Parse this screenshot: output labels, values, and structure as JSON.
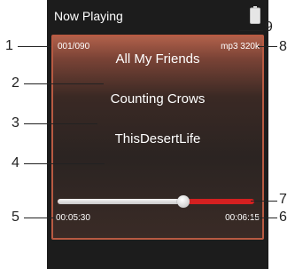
{
  "header": {
    "title": "Now Playing",
    "battery_icon": "battery-icon"
  },
  "track": {
    "number": "001/090",
    "format": "mp3 320k",
    "title": "All My Friends",
    "artist": "Counting Crows",
    "album": "ThisDesertLife"
  },
  "progress": {
    "elapsed": "00:05:30",
    "total": "00:06:15",
    "fraction": 0.64
  },
  "callouts": [
    "1",
    "2",
    "3",
    "4",
    "5",
    "6",
    "7",
    "8",
    "9"
  ],
  "colors": {
    "accent": "#d42020",
    "panel_border": "#b85a42",
    "background": "#1c1c1c"
  }
}
